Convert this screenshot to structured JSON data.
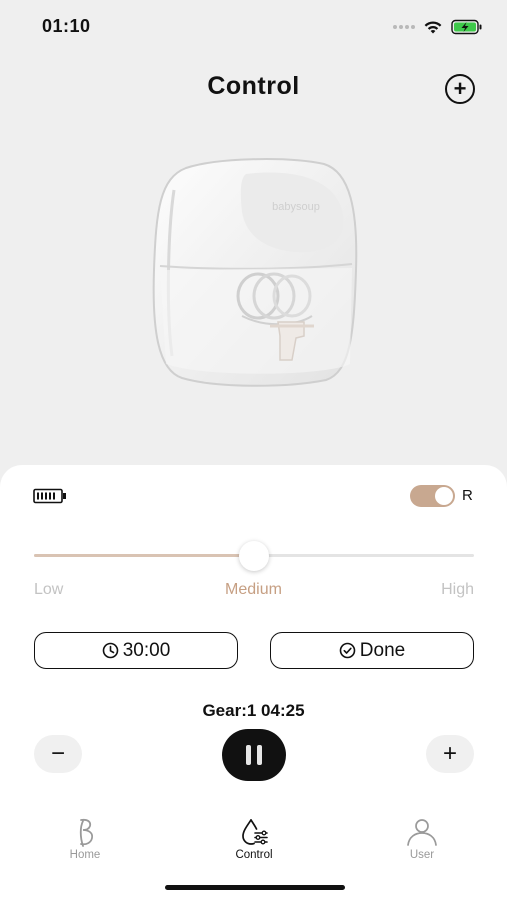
{
  "status_bar": {
    "time": "01:10"
  },
  "header": {
    "title": "Control",
    "add_button_icon": "plus-circle-icon"
  },
  "device": {
    "image": "breast-pump-product-image",
    "brand_mark": "babysoup"
  },
  "panel": {
    "battery_icon": "battery-icon",
    "side_toggle": {
      "label": "R",
      "on": true
    },
    "intensity_slider": {
      "value_fraction": 0.5,
      "labels": {
        "low": "Low",
        "medium": "Medium",
        "high": "High"
      },
      "selected": "Medium"
    },
    "timer_button": {
      "icon": "clock-icon",
      "label": "30:00"
    },
    "done_button": {
      "icon": "check-circle-icon",
      "label": "Done"
    },
    "gear_status": "Gear:1 04:25",
    "minus_label": "−",
    "plus_label": "+",
    "pause_icon": "pause-icon"
  },
  "tab_bar": {
    "items": [
      {
        "label": "Home",
        "icon": "brand-b-icon"
      },
      {
        "label": "Control",
        "icon": "droplet-settings-icon",
        "active": true
      },
      {
        "label": "User",
        "icon": "user-icon"
      }
    ]
  },
  "colors": {
    "accent": "#c69f83",
    "toggle_on": "#c8a890",
    "slider_fill": "#d9c3b3",
    "background": "#efefef",
    "panel": "#ffffff"
  }
}
